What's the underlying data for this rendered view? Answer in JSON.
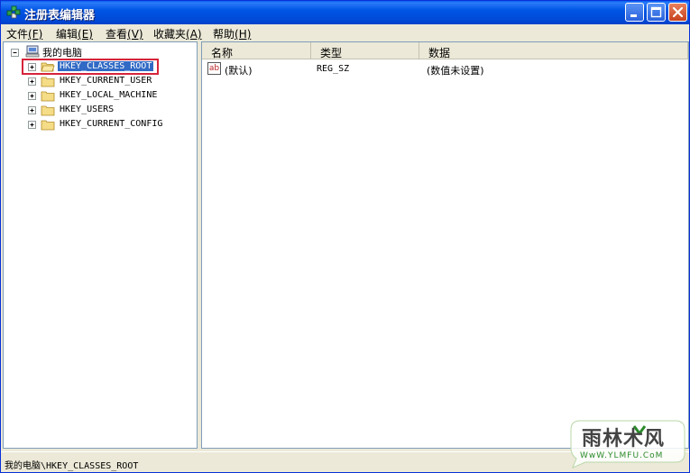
{
  "window": {
    "title": "注册表编辑器",
    "controls": [
      "minimize",
      "maximize",
      "close"
    ]
  },
  "menu": [
    {
      "label": "文件",
      "mnemonic": "(F)"
    },
    {
      "label": "编辑",
      "mnemonic": "(E)"
    },
    {
      "label": "查看",
      "mnemonic": "(V)"
    },
    {
      "label": "收藏夹",
      "mnemonic": "(A)"
    },
    {
      "label": "帮助",
      "mnemonic": "(H)"
    }
  ],
  "tree": {
    "root": "我的电脑",
    "keys": [
      {
        "label": "HKEY_CLASSES_ROOT",
        "selected": true
      },
      {
        "label": "HKEY_CURRENT_USER",
        "selected": false
      },
      {
        "label": "HKEY_LOCAL_MACHINE",
        "selected": false
      },
      {
        "label": "HKEY_USERS",
        "selected": false
      },
      {
        "label": "HKEY_CURRENT_CONFIG",
        "selected": false
      }
    ]
  },
  "list": {
    "columns": [
      "名称",
      "类型",
      "数据"
    ],
    "rows": [
      {
        "icon": "ab",
        "name": "(默认)",
        "type": "REG_SZ",
        "data": "(数值未设置)"
      }
    ]
  },
  "status": {
    "path": "我的电脑\\HKEY_CLASSES_ROOT"
  },
  "watermark": {
    "text": "雨林木风",
    "url": "WwW.YLMFU.CoM"
  },
  "colors": {
    "titlebar": "#0055e5",
    "selection": "#316ac5",
    "highlight_box": "#d6243a"
  }
}
